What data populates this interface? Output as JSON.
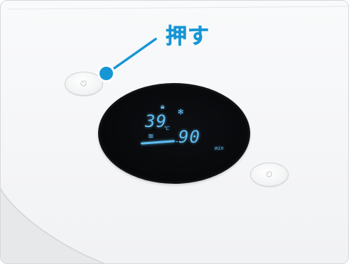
{
  "callout": {
    "label": "押す",
    "color": "#1796d6"
  },
  "display": {
    "temperature": "39",
    "temperature_unit": "℃",
    "time": "90",
    "time_unit": "min",
    "dashes": "- -"
  },
  "icons": {
    "left_button": "power-icon",
    "right_button": "power-icon",
    "lock_indicator": "lock-icon",
    "fan_indicator": "fan-icon",
    "heat_indicator": "heat-wave-icon"
  }
}
